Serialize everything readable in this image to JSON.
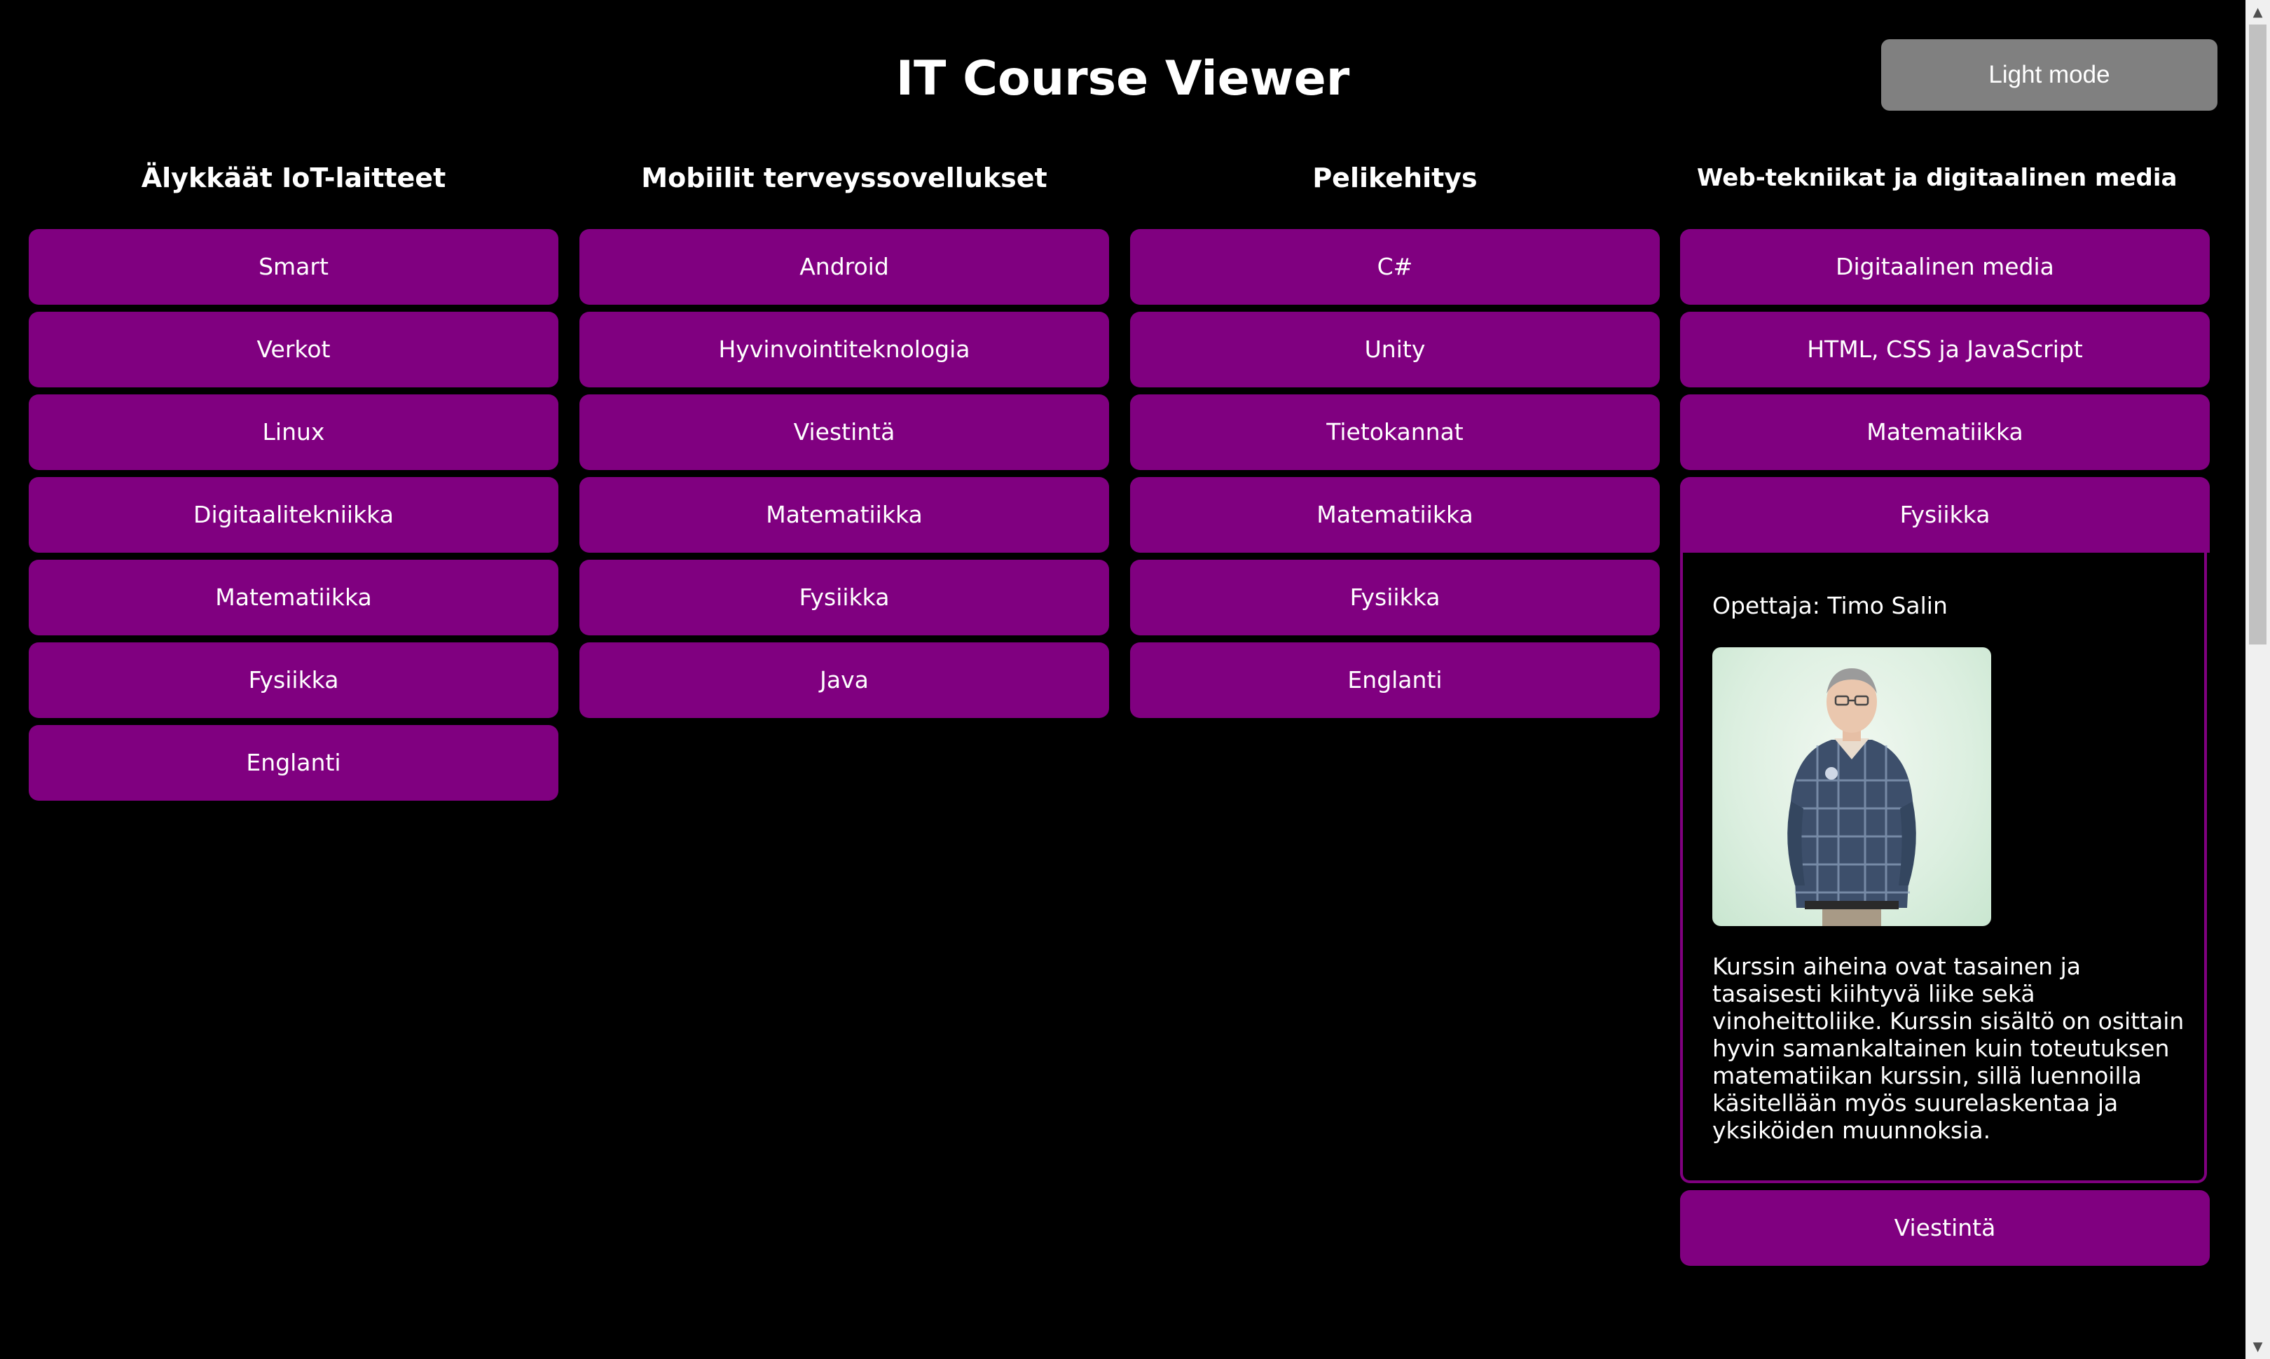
{
  "header": {
    "title": "IT Course Viewer",
    "mode_button_label": "Light mode"
  },
  "colors": {
    "background": "#000000",
    "course_button": "#800080",
    "mode_button": "#808080",
    "text": "#ffffff"
  },
  "columns": [
    {
      "heading": "Älykkäät IoT-laitteet",
      "courses": [
        "Smart",
        "Verkot",
        "Linux",
        "Digitaalitekniikka",
        "Matematiikka",
        "Fysiikka",
        "Englanti"
      ]
    },
    {
      "heading": "Mobiilit terveyssovellukset",
      "courses": [
        "Android",
        "Hyvinvointiteknologia",
        "Viestintä",
        "Matematiikka",
        "Fysiikka",
        "Java"
      ]
    },
    {
      "heading": "Pelikehitys",
      "courses": [
        "C#",
        "Unity",
        "Tietokannat",
        "Matematiikka",
        "Fysiikka",
        "Englanti"
      ]
    },
    {
      "heading": "Web-tekniikat ja digitaalinen media",
      "courses_before": [
        "Digitaalinen media",
        "HTML, CSS ja JavaScript",
        "Matematiikka"
      ],
      "expanded_course": "Fysiikka",
      "courses_after": [
        "Viestintä"
      ]
    }
  ],
  "expanded": {
    "teacher": "Opettaja: Timo Salin",
    "description": "Kurssin aiheina ovat tasainen ja tasaisesti kiihtyvä liike sekä vinoheittoliike. Kurssin sisältö on osittain hyvin samankaltainen kuin toteutuksen matematiikan kurssin, sillä luennoilla käsitellään myös suurelaskentaa ja yksiköiden muunnoksia."
  }
}
